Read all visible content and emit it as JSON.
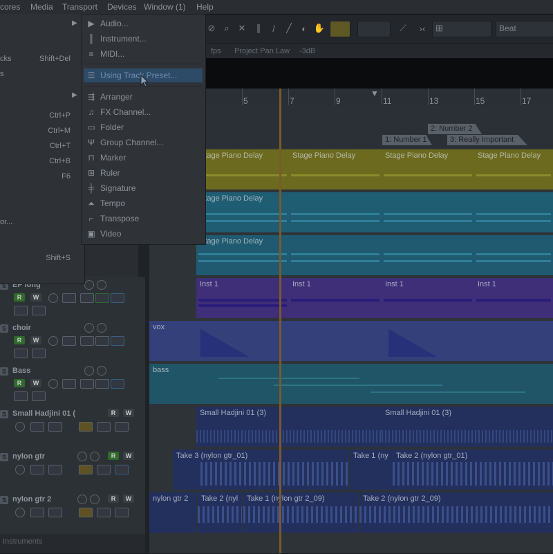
{
  "menubar": {
    "items": [
      "cores",
      "Media",
      "Transport",
      "Devices",
      "Window (1)",
      "Help"
    ]
  },
  "toolbar": {
    "snap_label": "Beat"
  },
  "infoline": {
    "fps": "fps",
    "pan_law_label": "Project Pan Law",
    "pan_law_value": "-3dB"
  },
  "ruler": {
    "numbers": [
      "5",
      "7",
      "9",
      "11",
      "13",
      "15",
      "17"
    ]
  },
  "markers": [
    {
      "label": "2: Number 2"
    },
    {
      "label": "1: Number 1"
    },
    {
      "label": "3: Really Important"
    }
  ],
  "left_menu": {
    "items": [
      {
        "label": "cks",
        "shortcut": "Shift+Del"
      },
      {
        "label": "s",
        "shortcut": ""
      },
      {
        "label": "",
        "shortcut": "Ctrl+P"
      },
      {
        "label": "",
        "shortcut": "Ctrl+M"
      },
      {
        "label": "",
        "shortcut": "Ctrl+T"
      },
      {
        "label": "",
        "shortcut": "Ctrl+B"
      },
      {
        "label": "",
        "shortcut": "F6"
      },
      {
        "label": "or...",
        "shortcut": ""
      },
      {
        "label": "",
        "shortcut": "Shift+S"
      }
    ]
  },
  "add_track_menu": {
    "items": [
      {
        "label": "Audio...",
        "icon": "audio-icon"
      },
      {
        "label": "Instrument...",
        "icon": "instrument-icon"
      },
      {
        "label": "MIDI...",
        "icon": "midi-icon"
      },
      {
        "label": "Using Track Preset...",
        "icon": "track-preset-icon",
        "highlighted": true
      },
      {
        "label": "Arranger",
        "icon": "arranger-icon"
      },
      {
        "label": "FX Channel...",
        "icon": "fx-channel-icon"
      },
      {
        "label": "Folder",
        "icon": "folder-icon"
      },
      {
        "label": "Group Channel...",
        "icon": "group-channel-icon"
      },
      {
        "label": "Marker",
        "icon": "marker-icon"
      },
      {
        "label": "Ruler",
        "icon": "ruler-icon"
      },
      {
        "label": "Signature",
        "icon": "signature-icon"
      },
      {
        "label": "Tempo",
        "icon": "tempo-icon"
      },
      {
        "label": "Transpose",
        "icon": "transpose-icon"
      },
      {
        "label": "Video",
        "icon": "video-icon"
      }
    ]
  },
  "tracks": [
    {
      "name": "EP long"
    },
    {
      "name": "choir"
    },
    {
      "name": "Bass"
    },
    {
      "name": "Small Hadjini 01 ("
    },
    {
      "name": "nylon gtr"
    },
    {
      "name": "nylon gtr 2"
    }
  ],
  "folder_label": "Instruments",
  "parts": {
    "stage_piano": "Stage Piano Delay",
    "inst": "Inst 1",
    "vox": "vox",
    "bass": "bass",
    "hadjini": "Small Hadjini 01 (3)",
    "take3": "Take 3 (nylon gtr_01)",
    "take1": "Take 1 (ny",
    "take2": "Take 2 (nylon gtr_01)",
    "nylon2": "nylon gtr 2",
    "take2b": "Take 2 (nyl",
    "take1b": "Take 1 (nylon gtr 2_09)",
    "take2c": "Take 2 (nylon gtr 2_09)"
  },
  "colors": {
    "stage_piano_yellow": "#6b6a1e",
    "stage_piano_cyan": "#1f5d72",
    "stage_piano_cyan2": "#1f5a70",
    "inst_purple": "#3e2f78",
    "vox_blue": "#33407a",
    "bass_teal": "#1f5566",
    "audio_blue": "#23305e",
    "highlight": "#2d4a66"
  }
}
